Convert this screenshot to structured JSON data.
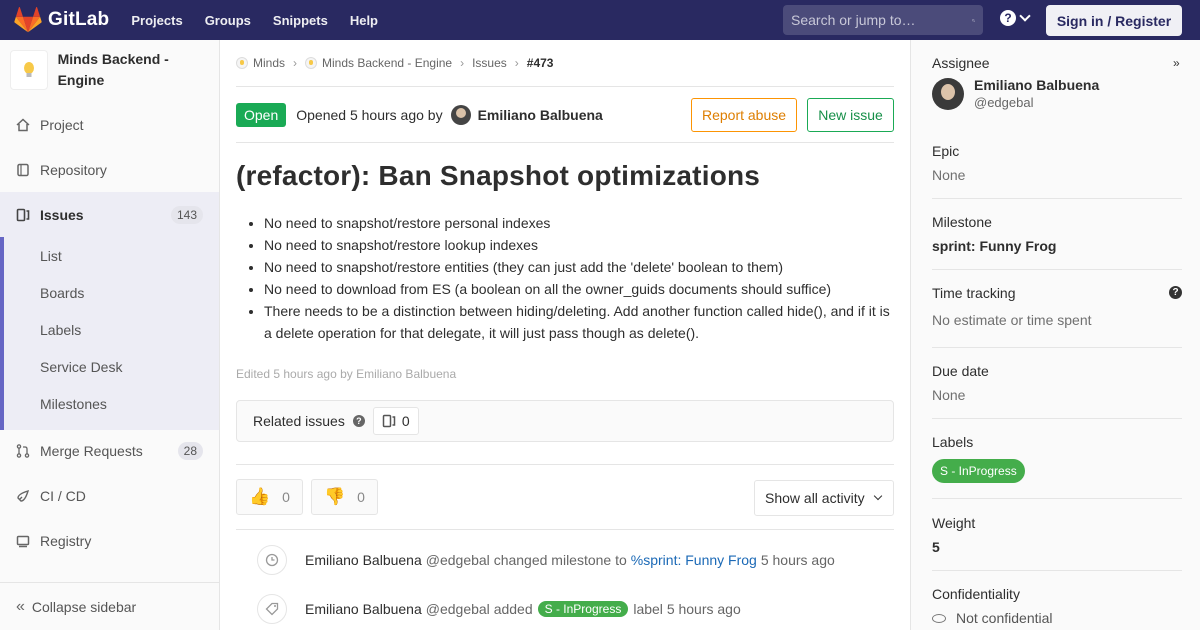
{
  "topbar": {
    "brand": "GitLab",
    "nav": [
      "Projects",
      "Groups",
      "Snippets",
      "Help"
    ],
    "search_placeholder": "Search or jump to…",
    "signin": "Sign in / Register"
  },
  "sidebar": {
    "project_name": "Minds Backend - Engine",
    "items": [
      {
        "label": "Project"
      },
      {
        "label": "Repository"
      },
      {
        "label": "Issues",
        "count": "143"
      }
    ],
    "subitems": [
      "List",
      "Boards",
      "Labels",
      "Service Desk",
      "Milestones"
    ],
    "items_after": [
      {
        "label": "Merge Requests",
        "count": "28"
      },
      {
        "label": "CI / CD"
      },
      {
        "label": "Registry"
      }
    ],
    "collapse": "Collapse sidebar"
  },
  "breadcrumb": [
    "Minds",
    "Minds Backend - Engine",
    "Issues",
    "#473"
  ],
  "issue": {
    "status": "Open",
    "opened_prefix": "Opened 5 hours ago by",
    "author": "Emiliano Balbuena",
    "report_abuse": "Report abuse",
    "new_issue": "New issue",
    "title": "(refactor): Ban Snapshot optimizations",
    "bullets": [
      "No need to snapshot/restore personal indexes",
      "No need to snapshot/restore lookup indexes",
      "No need to snapshot/restore entities (they can just add the 'delete' boolean to them)",
      "No need to download from ES (a boolean on all the owner_guids documents should suffice)",
      "There needs to be a distinction between hiding/deleting. Add another function called hide(), and if it is a delete operation for that delegate, it will just pass though as delete()."
    ],
    "edited": "Edited 5 hours ago by Emiliano Balbuena",
    "related_label": "Related issues",
    "related_count": "0",
    "thumbs_up": "0",
    "thumbs_down": "0",
    "activity_filter": "Show all activity"
  },
  "notes": [
    {
      "author": "Emiliano Balbuena",
      "handle": "@edgebal",
      "action": "changed milestone to",
      "link": "%sprint: Funny Frog",
      "time": "5 hours ago"
    },
    {
      "author": "Emiliano Balbuena",
      "handle": "@edgebal",
      "action": "added",
      "label": "S - InProgress",
      "suffix": "label",
      "time": "5 hours ago"
    }
  ],
  "rightbar": {
    "assignee_title": "Assignee",
    "assignee_name": "Emiliano Balbuena",
    "assignee_handle": "@edgebal",
    "epic_title": "Epic",
    "epic_val": "None",
    "milestone_title": "Milestone",
    "milestone_val": "sprint: Funny Frog",
    "time_title": "Time tracking",
    "time_val": "No estimate or time spent",
    "due_title": "Due date",
    "due_val": "None",
    "labels_title": "Labels",
    "label_val": "S - InProgress",
    "weight_title": "Weight",
    "weight_val": "5",
    "conf_title": "Confidentiality",
    "conf_val": "Not confidential"
  },
  "colors": {
    "topbar": "#292961",
    "open": "#1aaa55",
    "label": "#44ad4b",
    "link": "#1b69b6",
    "abuse": "#fc9403"
  }
}
